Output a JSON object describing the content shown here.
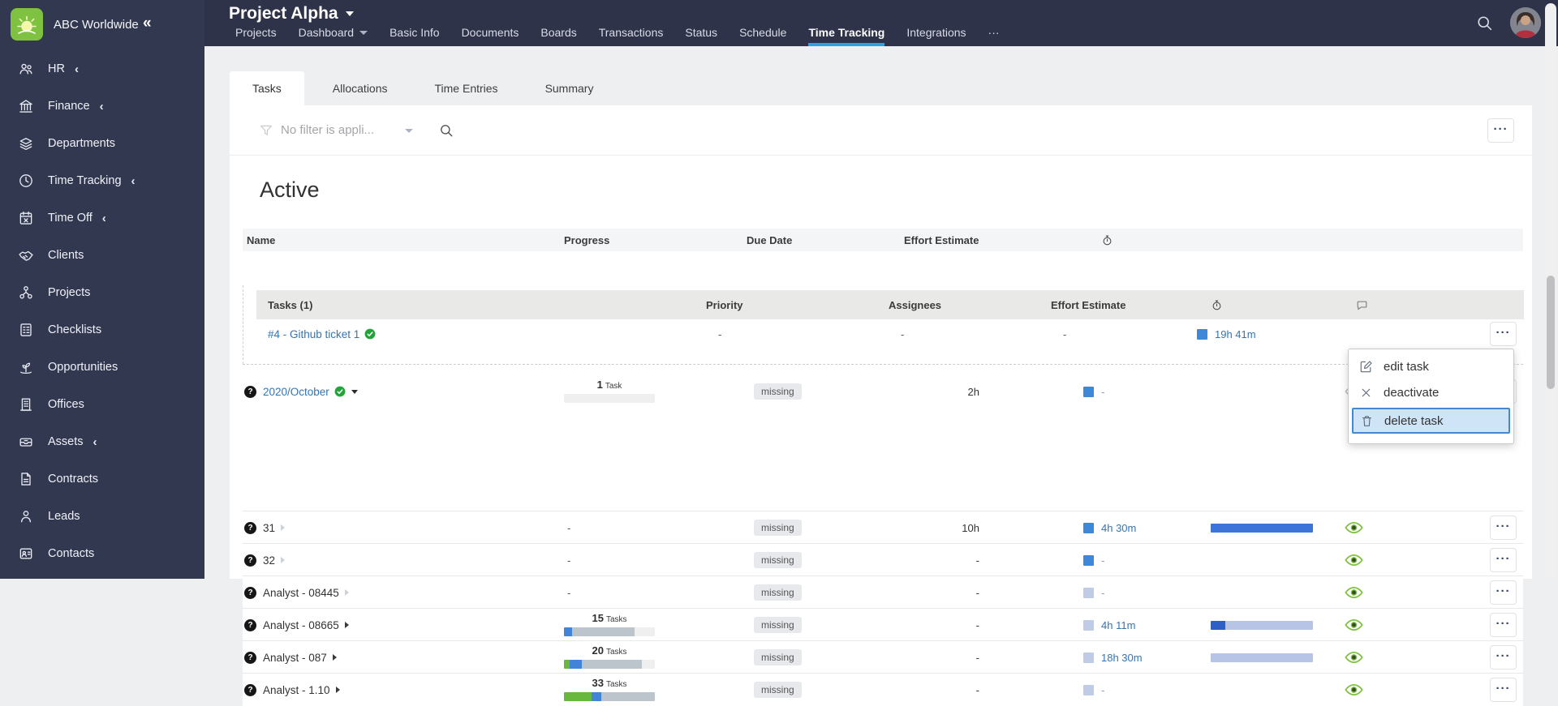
{
  "glyphs": {
    "more_dots": "···",
    "collapse": "«",
    "chevron": "‹",
    "question": "?",
    "dash": "-"
  },
  "colors": {
    "sidebar_bg": "#333851",
    "topbar_bg": "#2f3349",
    "nav_active_underline": "#2aa3e0",
    "link_blue": "#3374b3",
    "logo_green": "#7fc241",
    "check_green": "#23a43b",
    "eye_green": "#7fc143",
    "bar_green": "#67b83c",
    "bar_blue": "#4285d8",
    "bar_gray": "#bcc4cc",
    "bar_track": "#efeff0",
    "bar_navy": "#2f5fc4",
    "bar_periwinkle": "#b7c4e6",
    "bar_solid_blue": "#3d74d9",
    "timer_square_blue": "#3f87d7",
    "timer_square_light": "#c0cbe5",
    "menu_selected_bg": "#cfe4f7",
    "menu_selected_border": "#4488cf"
  },
  "icons": {
    "header_timer": "stopwatch",
    "subheader_timer": "stopwatch",
    "subheader_comments": "chat",
    "topbar_search": "magnifier",
    "filter_funnel": "funnel",
    "filter_search": "magnifier",
    "row_help": "question-badge",
    "visibility_on": "eye",
    "visibility_off": "eye-slash",
    "logo": "sunrise"
  },
  "sidebar": {
    "company": "ABC Worldwide",
    "items": [
      {
        "label": "HR",
        "icon": "people",
        "chevron": true
      },
      {
        "label": "Finance",
        "icon": "bank",
        "chevron": true
      },
      {
        "label": "Departments",
        "icon": "layers",
        "chevron": false
      },
      {
        "label": "Time Tracking",
        "icon": "clock",
        "chevron": true
      },
      {
        "label": "Time Off",
        "icon": "calendar-x",
        "chevron": true
      },
      {
        "label": "Clients",
        "icon": "handshake",
        "chevron": false
      },
      {
        "label": "Projects",
        "icon": "org",
        "chevron": false
      },
      {
        "label": "Checklists",
        "icon": "checklist",
        "chevron": false
      },
      {
        "label": "Opportunities",
        "icon": "sprout",
        "chevron": false
      },
      {
        "label": "Offices",
        "icon": "building",
        "chevron": false
      },
      {
        "label": "Assets",
        "icon": "drawer",
        "chevron": true
      },
      {
        "label": "Contracts",
        "icon": "document",
        "chevron": false
      },
      {
        "label": "Leads",
        "icon": "person",
        "chevron": false
      },
      {
        "label": "Contacts",
        "icon": "id-card",
        "chevron": false
      }
    ]
  },
  "topbar": {
    "title": "Project Alpha",
    "nav": [
      {
        "label": "Projects"
      },
      {
        "label": "Dashboard",
        "caret": true
      },
      {
        "label": "Basic Info"
      },
      {
        "label": "Documents"
      },
      {
        "label": "Boards"
      },
      {
        "label": "Transactions"
      },
      {
        "label": "Status"
      },
      {
        "label": "Schedule"
      },
      {
        "label": "Time Tracking",
        "active": true
      },
      {
        "label": "Integrations"
      },
      {
        "label": "···"
      }
    ]
  },
  "tabs": {
    "items": [
      "Tasks",
      "Allocations",
      "Time Entries",
      "Summary"
    ],
    "active": "Tasks"
  },
  "filter": {
    "label": "No filter is appli..."
  },
  "section": {
    "title": "Active"
  },
  "table": {
    "headers": {
      "name": "Name",
      "progress": "Progress",
      "due": "Due Date",
      "effort": "Effort Estimate"
    },
    "rows": [
      {
        "name": "2020/October",
        "link": true,
        "check": true,
        "caret": "down-dark",
        "expanded": true,
        "progress": {
          "count": "1",
          "unit": "Task",
          "segments": []
        },
        "due": "missing",
        "effort": "2h",
        "timer": {
          "square": "blue",
          "text": "-"
        },
        "bar": [],
        "eye": "off",
        "more": true
      },
      {
        "name": "31",
        "link": false,
        "caret": "right-light",
        "progress": null,
        "due": "missing",
        "effort": "10h",
        "timer": {
          "square": "blue",
          "text": "4h 30m"
        },
        "bar": [
          {
            "color": "bar_solid_blue",
            "frac": 1
          }
        ],
        "eye": "on",
        "more": true
      },
      {
        "name": "32",
        "link": false,
        "caret": "right-light",
        "progress": null,
        "due": "missing",
        "effort": "-",
        "timer": {
          "square": "blue",
          "text": "-"
        },
        "bar": [],
        "eye": "on",
        "more": true
      },
      {
        "name": "Analyst - 08445",
        "link": false,
        "caret": "right-light",
        "progress": null,
        "due": "missing",
        "effort": "-",
        "timer": {
          "square": "light",
          "text": "-"
        },
        "bar": [],
        "eye": "on",
        "more": true
      },
      {
        "name": "Analyst - 08665",
        "link": false,
        "caret": "right-dark",
        "progress": {
          "count": "15",
          "unit": "Tasks",
          "segments": [
            {
              "color": "bar_blue",
              "frac": 0.09
            },
            {
              "color": "bar_gray",
              "frac": 0.69
            }
          ]
        },
        "due": "missing",
        "effort": "-",
        "timer": {
          "square": "light",
          "text": "4h 11m"
        },
        "bar": [
          {
            "color": "bar_navy",
            "frac": 0.14
          },
          {
            "color": "bar_periwinkle",
            "frac": 0.86
          }
        ],
        "eye": "on",
        "more": true
      },
      {
        "name": "Analyst - 087",
        "link": false,
        "caret": "right-dark",
        "progress": {
          "count": "20",
          "unit": "Tasks",
          "segments": [
            {
              "color": "bar_green",
              "frac": 0.06
            },
            {
              "color": "bar_blue",
              "frac": 0.13
            },
            {
              "color": "bar_gray",
              "frac": 0.66
            }
          ]
        },
        "due": "missing",
        "effort": "-",
        "timer": {
          "square": "light",
          "text": "18h 30m"
        },
        "bar": [
          {
            "color": "bar_periwinkle",
            "frac": 1
          }
        ],
        "eye": "on",
        "more": true
      },
      {
        "name": "Analyst - 1.10",
        "link": false,
        "caret": "right-dark",
        "progress": {
          "count": "33",
          "unit": "Tasks",
          "segments": [
            {
              "color": "bar_green",
              "frac": 0.3
            },
            {
              "color": "bar_blue",
              "frac": 0.11
            },
            {
              "color": "bar_gray",
              "frac": 0.59
            }
          ]
        },
        "due": "missing",
        "effort": "-",
        "timer": {
          "square": "light",
          "text": "-"
        },
        "bar": [],
        "eye": "on",
        "more": true
      }
    ],
    "subtable": {
      "title": "Tasks (1)",
      "headers": {
        "priority": "Priority",
        "assignees": "Assignees",
        "effort": "Effort Estimate"
      },
      "rows": [
        {
          "name": "#4 - Github ticket 1",
          "check": true,
          "priority": "-",
          "assignees": "-",
          "effort": "-",
          "timer": {
            "square": "blue",
            "text": "19h 41m"
          },
          "more": true
        }
      ]
    }
  },
  "context_menu": {
    "items": [
      {
        "label": "edit task",
        "icon": "edit",
        "selected": false
      },
      {
        "label": "deactivate",
        "icon": "x",
        "selected": false
      },
      {
        "label": "delete task",
        "icon": "trash",
        "selected": true
      }
    ]
  }
}
